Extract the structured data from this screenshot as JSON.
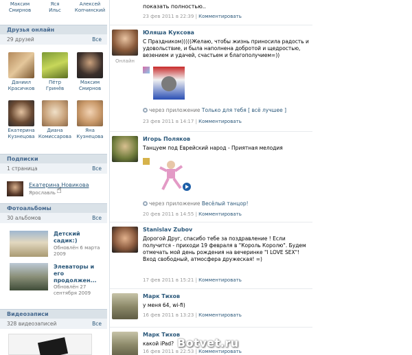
{
  "top_friends": [
    {
      "first": "Максим",
      "last": "Смирнов"
    },
    {
      "first": "Яся",
      "last": "Ильс"
    },
    {
      "first": "Алексей",
      "last": "Копчинский"
    }
  ],
  "friends_online": {
    "title": "Друзья онлайн",
    "count": "29 друзей",
    "all": "Все",
    "people": [
      {
        "first": "Даниил",
        "last": "Красичков"
      },
      {
        "first": "Пётр",
        "last": "Гринёв"
      },
      {
        "first": "Максим",
        "last": "Смирнов"
      },
      {
        "first": "Екатерина",
        "last": "Кузнецова"
      },
      {
        "first": "Диана",
        "last": "Комиссарова"
      },
      {
        "first": "Яна",
        "last": "Кузнецова"
      }
    ]
  },
  "subscriptions": {
    "title": "Подписки",
    "count": "1 страница",
    "all": "Все",
    "name": "Екатерина Новикова",
    "city": "Ярославль"
  },
  "albums": {
    "title": "Фотоальбомы",
    "count": "30 альбомов",
    "all": "Все",
    "items": [
      {
        "title": "Детский садик:)",
        "updated": "Обновлён 6 марта 2009"
      },
      {
        "title": "Элеваторы и его продолжен...",
        "updated": "Обновлён 27 сентября 2009"
      }
    ]
  },
  "videos": {
    "title": "Видеозаписи",
    "count": "328 видеозаписей",
    "all": "Все"
  },
  "feed": {
    "top_text": "показать полностью..",
    "top_meta": "23 фев 2011 в 22:39",
    "comment_label": "Комментировать",
    "posts": [
      {
        "name": "Юляша Куксова",
        "status": "Онлайн",
        "text": "С Праздником)))))Желаю, чтобы жизнь приносила радость и удовольствие, и была наполнена добротой и щедростью, везением и удачей, счастьем и благополучием=))",
        "app_prefix": "через приложение",
        "app_name": "Только для тебя [ всё лучшее ]",
        "time": "23 фев 2011 в 14:17"
      },
      {
        "name": "Игорь Поляков",
        "text": "Танцуем под Еврейский народ - Приятная мелодия",
        "app_prefix": "через приложение",
        "app_name": "Весёлый танцор!",
        "time": "20 фев 2011 в 14:55"
      },
      {
        "name": "Stanislav Zubov",
        "text": "Дорогой Друг, спасибо тебе за поздравление ! Если получится - приходи 19 февраля в \"Король Королю\". Будем отмечать мой день рождения на вечеринке \"I LOVE SEX\"! Вход свободный, атмосфера дружеская! =)",
        "time": "17 фев 2011 в 15:21"
      },
      {
        "name": "Марк Тихов",
        "text": "у меня 64, wi-fi)",
        "time": "16 фев 2011 в 13:23"
      },
      {
        "name": "Марк Тихов",
        "text": "какой iPad?",
        "time": "16 фев 2011 в 22:53"
      }
    ]
  },
  "watermark": "Botvet.ru",
  "colors": {
    "link": "#2b587a",
    "header_bg": "#dae2e8",
    "subheader_bg": "#eef2f6"
  }
}
